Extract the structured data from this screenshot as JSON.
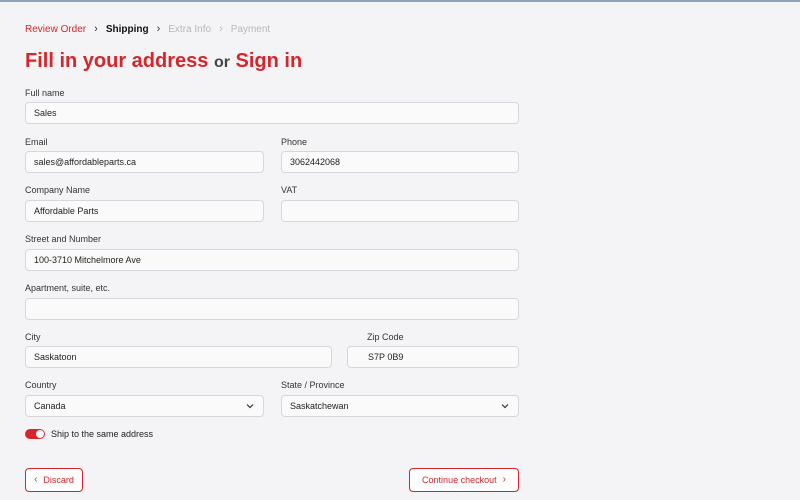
{
  "breadcrumb": [
    {
      "label": "Review Order",
      "state": "active"
    },
    {
      "label": "Shipping",
      "state": "current"
    },
    {
      "label": "Extra Info",
      "state": "muted"
    },
    {
      "label": "Payment",
      "state": "muted"
    }
  ],
  "title": {
    "part1": "Fill in your address",
    "or": "or",
    "part2": "Sign in"
  },
  "form": {
    "full_name": {
      "label": "Full name",
      "value": "Sales"
    },
    "email": {
      "label": "Email",
      "value": "sales@affordableparts.ca"
    },
    "phone": {
      "label": "Phone",
      "value": "3062442068"
    },
    "company": {
      "label": "Company Name",
      "value": "Affordable Parts"
    },
    "vat": {
      "label": "VAT",
      "value": ""
    },
    "street": {
      "label": "Street and Number",
      "value": "100-3710 Mitchelmore Ave"
    },
    "apartment": {
      "label": "Apartment, suite, etc.",
      "value": ""
    },
    "city": {
      "label": "City",
      "value": "Saskatoon"
    },
    "zip": {
      "label": "Zip Code",
      "value": "S7P 0B9"
    },
    "country": {
      "label": "Country",
      "value": "Canada"
    },
    "state": {
      "label": "State / Province",
      "value": "Saskatchewan"
    }
  },
  "ship_same": {
    "label": "Ship to the same address",
    "on": true
  },
  "buttons": {
    "discard": "Discard",
    "continue": "Continue checkout"
  },
  "colors": {
    "accent": "#d7262b",
    "border": "#d6d6dc",
    "background": "#f4f4f6"
  }
}
